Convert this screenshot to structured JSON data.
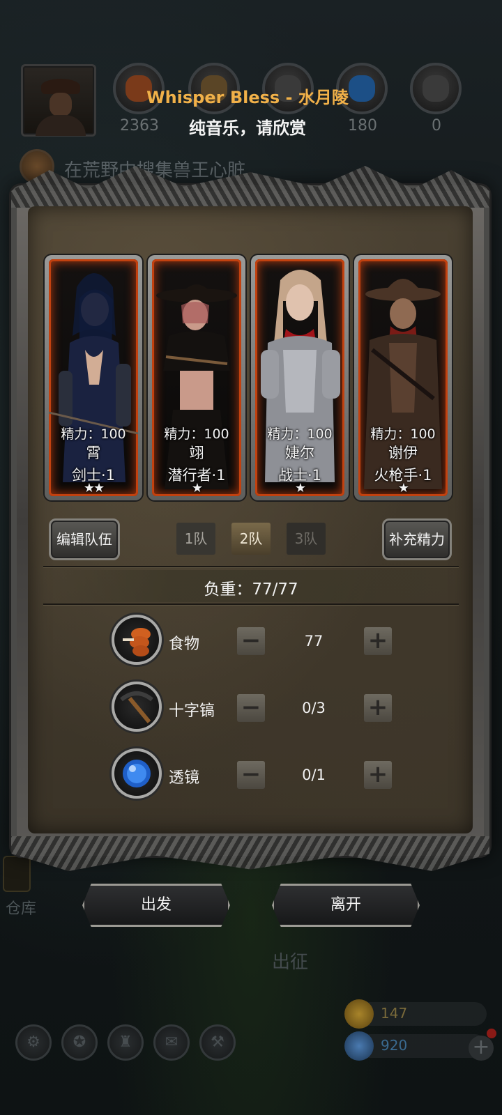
{
  "background": {
    "resources": [
      {
        "icon": "meat-icon",
        "count": "2363",
        "color": "#c0541e"
      },
      {
        "icon": "wood-icon",
        "count": "",
        "color": "#8a6a3a"
      },
      {
        "icon": "stone-icon",
        "count": "",
        "color": "#555555"
      },
      {
        "icon": "crystal-icon",
        "count": "180",
        "color": "#2a7ad0"
      },
      {
        "icon": "iron-icon",
        "count": "0",
        "color": "#5a5a5a"
      }
    ],
    "quest": "在荒野中搜集兽王心脏",
    "side_label": "仓库",
    "center_label": "出征",
    "gold": "147",
    "gems": "920"
  },
  "music": {
    "title": "Whisper Bless - 水月陵",
    "subtitle": "纯音乐，请欣赏"
  },
  "heroes": [
    {
      "stat": "精力：100",
      "name": "霄",
      "class": "剑士·1",
      "stars": "★★"
    },
    {
      "stat": "精力：100",
      "name": "翊",
      "class": "潜行者·1",
      "stars": "★"
    },
    {
      "stat": "精力：100",
      "name": "婕尔",
      "class": "战士·1",
      "stars": "★"
    },
    {
      "stat": "精力：100",
      "name": "谢伊",
      "class": "火枪手·1",
      "stars": "★"
    }
  ],
  "controls": {
    "edit_team": "编辑队伍",
    "teams": [
      "1队",
      "2队",
      "3队"
    ],
    "active_team": "2队",
    "refill": "补充精力"
  },
  "load": {
    "label": "负重：77/77"
  },
  "items": [
    {
      "icon": "food-icon",
      "name": "食物",
      "value": "77"
    },
    {
      "icon": "pickaxe-icon",
      "name": "十字镐",
      "value": "0/3"
    },
    {
      "icon": "lens-icon",
      "name": "透镜",
      "value": "0/1"
    }
  ],
  "actions": {
    "depart": "出发",
    "leave": "离开"
  },
  "symbols": {
    "minus": "−",
    "plus": "+"
  }
}
